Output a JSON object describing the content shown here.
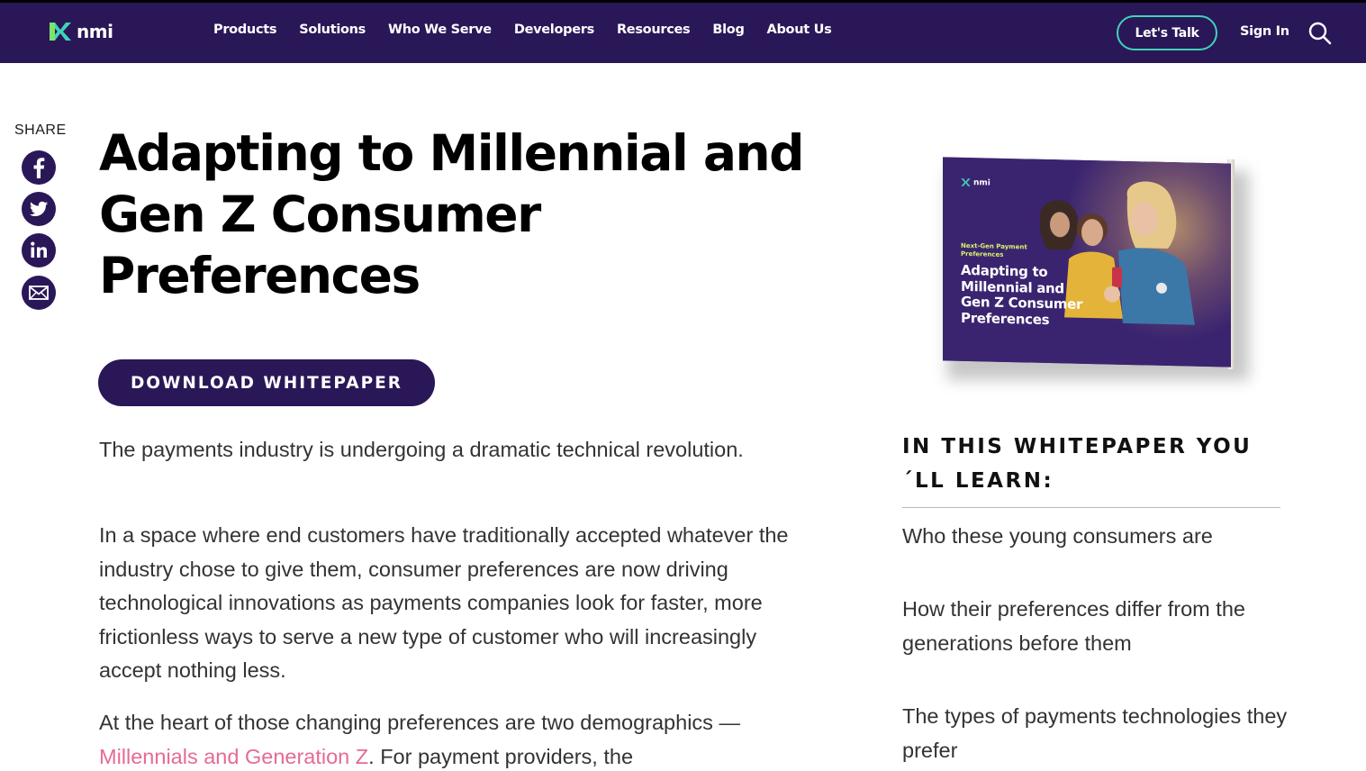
{
  "nav": {
    "logo_text": "nmi",
    "links": [
      "Products",
      "Solutions",
      "Who We Serve",
      "Developers",
      "Resources",
      "Blog",
      "About Us"
    ],
    "cta": "Let's Talk",
    "signin": "Sign In"
  },
  "share": {
    "label": "SHARE"
  },
  "article": {
    "title": "Adapting to Millennial and Gen Z Consumer Preferences",
    "download_button": "DOWNLOAD WHITEPAPER",
    "para1": "The payments industry is undergoing a dramatic technical revolution.",
    "para2": "In a space where end customers have traditionally accepted whatever the industry chose to give them, consumer preferences are now driving technological innovations as payments companies look for faster, more frictionless ways to serve a new type of customer who will increasingly accept nothing less.",
    "para3_before": "At the heart of those changing preferences are two demographics — ",
    "para3_link": "Millennials and Generation Z",
    "para3_after": ". For payment providers, the"
  },
  "book": {
    "logo_text": "nmi",
    "kicker": "Next-Gen Payment Preferences",
    "title": "Adapting to Millennial and Gen Z Consumer Preferences"
  },
  "learn": {
    "heading": "IN THIS WHITEPAPER YOU´LL LEARN:",
    "items": [
      "Who these young consumers are",
      "How their preferences differ from the generations before them",
      "The types of payments technologies they prefer"
    ]
  },
  "colors": {
    "brand": "#2a1758",
    "accent": "#3fd3b8",
    "link": "#e56b93"
  }
}
